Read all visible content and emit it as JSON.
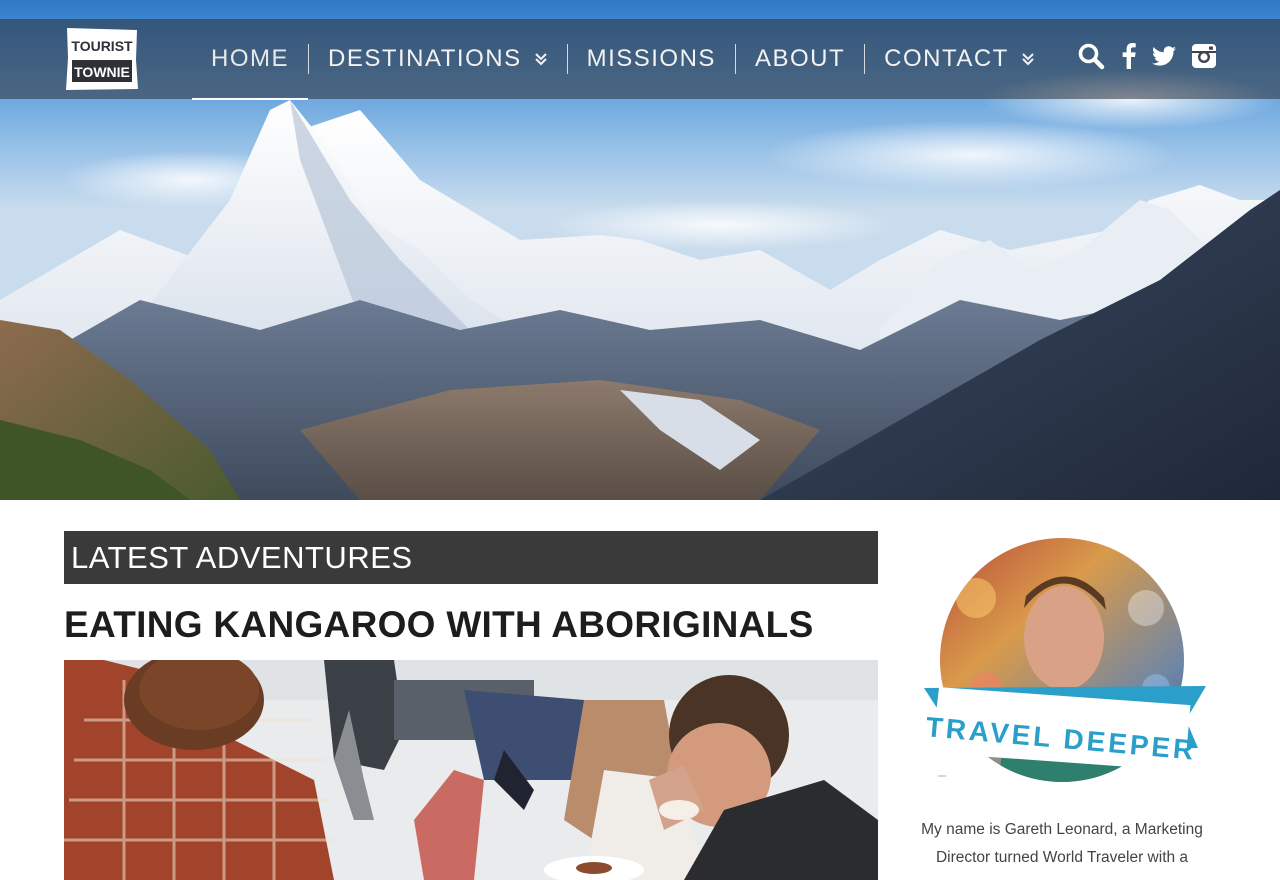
{
  "site": {
    "logo_line1": "TOURIST",
    "logo_line2": "TOWNIE"
  },
  "nav": {
    "items": [
      {
        "label": "HOME",
        "active": true,
        "has_dropdown": false
      },
      {
        "label": "DESTINATIONS",
        "active": false,
        "has_dropdown": true
      },
      {
        "label": "MISSIONS",
        "active": false,
        "has_dropdown": false
      },
      {
        "label": "ABOUT",
        "active": false,
        "has_dropdown": false
      },
      {
        "label": "CONTACT",
        "active": false,
        "has_dropdown": true
      }
    ],
    "icons": [
      "search-icon",
      "facebook-icon",
      "twitter-icon",
      "instagram-icon"
    ]
  },
  "main": {
    "section_heading": "LATEST ADVENTURES",
    "post_title": "EATING KANGAROO WITH ABORIGINALS"
  },
  "sidebar": {
    "badge_text": "TRAVEL DEEPER",
    "bio": "My name is Gareth Leonard, a Marketing Director turned World Traveler with a"
  },
  "colors": {
    "navbar": "#2d3037",
    "section_heading_bg": "#3a3a3a",
    "ribbon": "#2a9fc9",
    "text_dark": "#1d1d1d"
  }
}
